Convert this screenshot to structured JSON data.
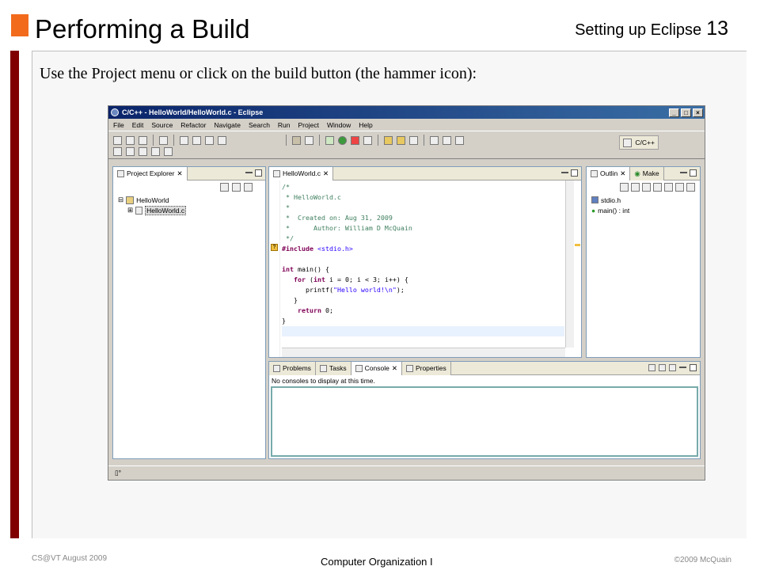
{
  "slide": {
    "title": "Performing a Build",
    "header_right": "Setting up Eclipse",
    "page_number": "13",
    "intro": "Use the Project menu or click on the build button (the hammer icon):",
    "footer_left": "CS@VT August 2009",
    "footer_center": "Computer Organization I",
    "footer_right": "©2009  McQuain",
    "accent_orange": "#f26b1d",
    "accent_maroon": "#800000"
  },
  "eclipse": {
    "window_title": "C/C++ - HelloWorld/HelloWorld.c - Eclipse",
    "menu": [
      "File",
      "Edit",
      "Source",
      "Refactor",
      "Navigate",
      "Search",
      "Run",
      "Project",
      "Window",
      "Help"
    ],
    "perspective_label": "C/C++",
    "project_explorer": {
      "tab_label": "Project Explorer",
      "project": "HelloWorld",
      "file": "HelloWorld.c"
    },
    "editor": {
      "tab_label": "HelloWorld.c",
      "code": {
        "l1": "/*",
        "l2": " * HelloWorld.c",
        "l3": " *",
        "l4": " *  Created on: Aug 31, 2009",
        "l5": " *      Author: William D McQuain",
        "l6": " */",
        "l7_directive": "#include",
        "l7_header": "<stdio.h>",
        "l9_kw": "int",
        "l9_rest": " main() {",
        "l10_kw1": "for",
        "l10_mid": " (",
        "l10_kw2": "int",
        "l10_rest": " i = 0; i < 3; i++) {",
        "l11_a": "printf(",
        "l11_str": "\"Hello world!\\n\"",
        "l11_b": ");",
        "l12": "}",
        "l13_kw": "return",
        "l13_rest": " 0;",
        "l14": "}"
      }
    },
    "outline": {
      "tab_outline": "Outlin",
      "tab_make": "Make",
      "items": [
        "stdio.h",
        "main() : int"
      ]
    },
    "bottom": {
      "tabs": [
        "Problems",
        "Tasks",
        "Console",
        "Properties"
      ],
      "message": "No consoles to display at this time."
    }
  }
}
